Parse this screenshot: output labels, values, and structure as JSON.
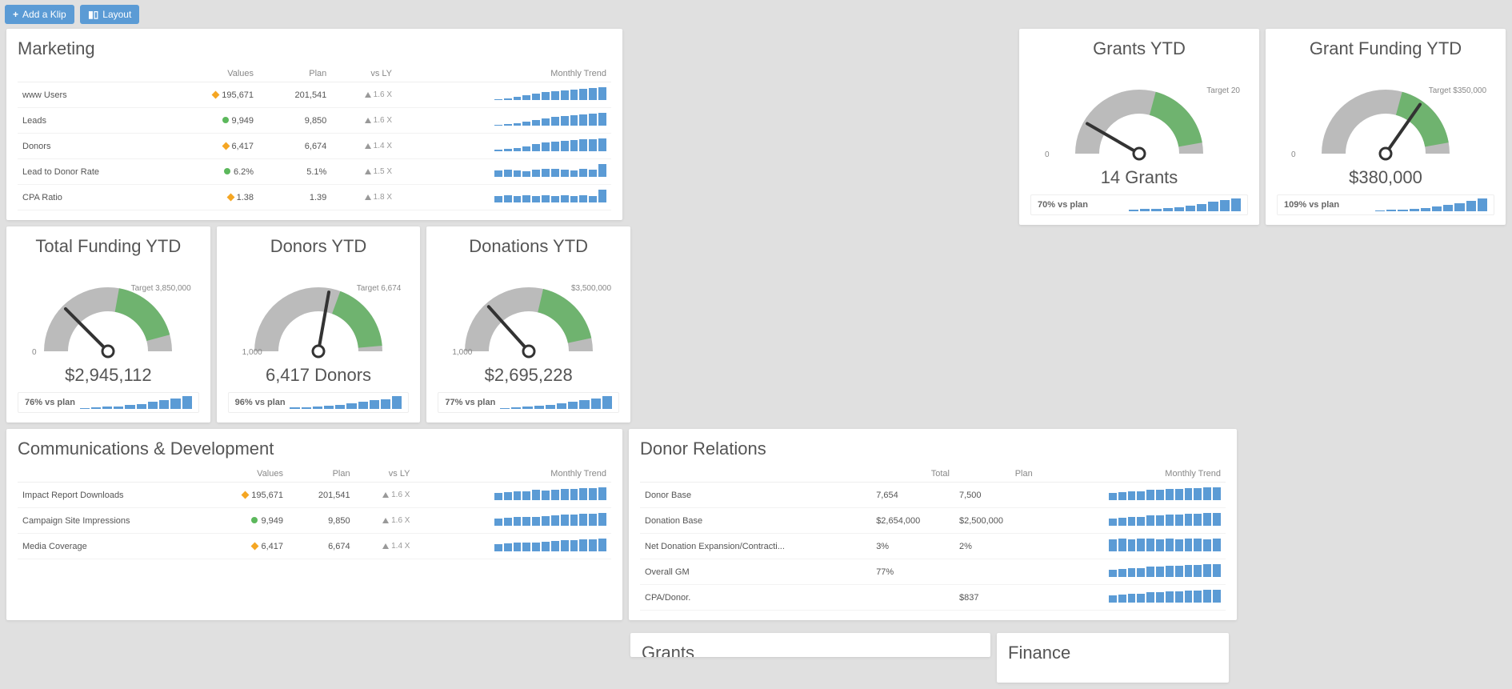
{
  "toolbar": {
    "add_label": "Add a Klip",
    "layout_label": "Layout"
  },
  "marketing": {
    "title": "Marketing",
    "headers": [
      "",
      "Values",
      "Plan",
      "vs LY",
      "Monthly Trend"
    ],
    "rows": [
      {
        "label": "www Users",
        "ind": "diamond",
        "value": "195,671",
        "plan": "201,541",
        "vsly": "1.6 X",
        "spark": [
          5,
          10,
          20,
          30,
          40,
          50,
          55,
          60,
          65,
          70,
          75,
          80
        ]
      },
      {
        "label": "Leads",
        "ind": "circle",
        "value": "9,949",
        "plan": "9,850",
        "vsly": "1.6 X",
        "spark": [
          5,
          10,
          15,
          25,
          35,
          45,
          55,
          60,
          65,
          70,
          75,
          80
        ]
      },
      {
        "label": "Donors",
        "ind": "diamond",
        "value": "6,417",
        "plan": "6,674",
        "vsly": "1.4 X",
        "spark": [
          10,
          15,
          20,
          30,
          40,
          50,
          55,
          60,
          65,
          70,
          72,
          75
        ]
      },
      {
        "label": "Lead to Donor Rate",
        "ind": "circle",
        "value": "6.2%",
        "plan": "5.1%",
        "vsly": "1.5 X",
        "spark": [
          20,
          22,
          20,
          18,
          22,
          24,
          24,
          22,
          20,
          24,
          22,
          40
        ],
        "break": true
      },
      {
        "label": "CPA Ratio",
        "ind": "diamond",
        "value": "1.38",
        "plan": "1.39",
        "vsly": "1.8 X",
        "spark": [
          20,
          22,
          20,
          22,
          20,
          22,
          20,
          22,
          20,
          22,
          20,
          40
        ]
      }
    ]
  },
  "grants_ytd": {
    "title": "Grants YTD",
    "target_label": "Target 20",
    "zero": "0",
    "value": "14 Grants",
    "pct": "70% vs plan",
    "angle": -60,
    "fill_start": 20,
    "spark": [
      10,
      12,
      14,
      16,
      20,
      30,
      40,
      52,
      60,
      70
    ]
  },
  "grant_funding_ytd": {
    "title": "Grant Funding YTD",
    "target_label": "Target $350,000",
    "zero": "0",
    "value": "$380,000",
    "pct": "109% vs plan",
    "angle": 35,
    "fill_start": 20,
    "spark": [
      5,
      8,
      12,
      16,
      22,
      30,
      40,
      50,
      65,
      80
    ]
  },
  "total_funding_ytd": {
    "title": "Total Funding YTD",
    "target_label": "Target 3,850,000",
    "zero": "0",
    "value": "$2,945,112",
    "pct": "76% vs plan",
    "angle": -45,
    "fill_start": 25,
    "spark": [
      5,
      8,
      12,
      16,
      22,
      30,
      40,
      50,
      60,
      75
    ]
  },
  "donors_ytd": {
    "title": "Donors YTD",
    "target_label": "Target 6,674",
    "zero": "1,000",
    "value": "6,417 Donors",
    "pct": "96% vs plan",
    "angle": 10,
    "fill_start": 15,
    "spark": [
      8,
      10,
      14,
      18,
      24,
      32,
      40,
      48,
      56,
      72
    ]
  },
  "donations_ytd": {
    "title": "Donations YTD",
    "target_label": "$3,500,000",
    "zero": "1,000",
    "value": "$2,695,228",
    "pct": "77% vs plan",
    "angle": -42,
    "fill_start": 22,
    "spark": [
      6,
      9,
      13,
      18,
      25,
      33,
      42,
      50,
      58,
      74
    ]
  },
  "comm_dev": {
    "title": "Communications & Development",
    "headers": [
      "",
      "Values",
      "Plan",
      "vs LY",
      "Monthly Trend"
    ],
    "rows": [
      {
        "label": "Impact Report Downloads",
        "ind": "diamond",
        "value": "195,671",
        "plan": "201,541",
        "vsly": "1.6 X",
        "spark": [
          40,
          45,
          48,
          50,
          55,
          52,
          58,
          60,
          62,
          64,
          66,
          70
        ]
      },
      {
        "label": "Campaign Site Impressions",
        "ind": "circle",
        "value": "9,949",
        "plan": "9,850",
        "vsly": "1.6 X",
        "spark": [
          40,
          45,
          48,
          50,
          50,
          52,
          58,
          60,
          62,
          64,
          66,
          70
        ]
      },
      {
        "label": "Media Coverage",
        "ind": "diamond",
        "value": "6,417",
        "plan": "6,674",
        "vsly": "1.4 X",
        "spark": [
          40,
          45,
          48,
          50,
          50,
          52,
          58,
          60,
          62,
          64,
          66,
          70
        ]
      }
    ]
  },
  "donor_rel": {
    "title": "Donor Relations",
    "headers": [
      "",
      "Total",
      "Plan",
      "Monthly Trend"
    ],
    "rows": [
      {
        "label": "Donor Base",
        "total": "7,654",
        "plan": "7,500",
        "spark": [
          40,
          45,
          48,
          50,
          55,
          58,
          60,
          62,
          64,
          66,
          68,
          70
        ]
      },
      {
        "label": "Donation Base",
        "total": "$2,654,000",
        "plan": "$2,500,000",
        "spark": [
          40,
          45,
          48,
          50,
          55,
          58,
          60,
          62,
          64,
          66,
          68,
          70
        ]
      },
      {
        "label": "Net Donation Expansion/Contracti...",
        "total": "3%",
        "plan": "2%",
        "spark": [
          20,
          22,
          20,
          22,
          22,
          20,
          22,
          20,
          22,
          22,
          20,
          22
        ]
      },
      {
        "label": "Overall GM",
        "total": "77%",
        "plan": "",
        "spark": [
          40,
          45,
          48,
          50,
          55,
          58,
          60,
          62,
          64,
          66,
          68,
          70
        ],
        "break": true
      },
      {
        "label": "CPA/Donor.",
        "total": "",
        "plan": "$837",
        "spark": [
          40,
          45,
          48,
          50,
          55,
          58,
          60,
          62,
          64,
          66,
          68,
          70
        ],
        "break": true
      }
    ]
  },
  "partial_left": {
    "title": "Grants"
  },
  "partial_right": {
    "title": "Finance"
  },
  "chart_data": [
    {
      "type": "gauge",
      "title": "Grants YTD",
      "value": 14,
      "target": 20,
      "min": 0
    },
    {
      "type": "gauge",
      "title": "Grant Funding YTD",
      "value": 380000,
      "target": 350000,
      "min": 0
    },
    {
      "type": "gauge",
      "title": "Total Funding YTD",
      "value": 2945112,
      "target": 3850000,
      "min": 0
    },
    {
      "type": "gauge",
      "title": "Donors YTD",
      "value": 6417,
      "target": 6674,
      "min": 1000
    },
    {
      "type": "gauge",
      "title": "Donations YTD",
      "value": 2695228,
      "target": 3500000,
      "min": 1000
    }
  ]
}
